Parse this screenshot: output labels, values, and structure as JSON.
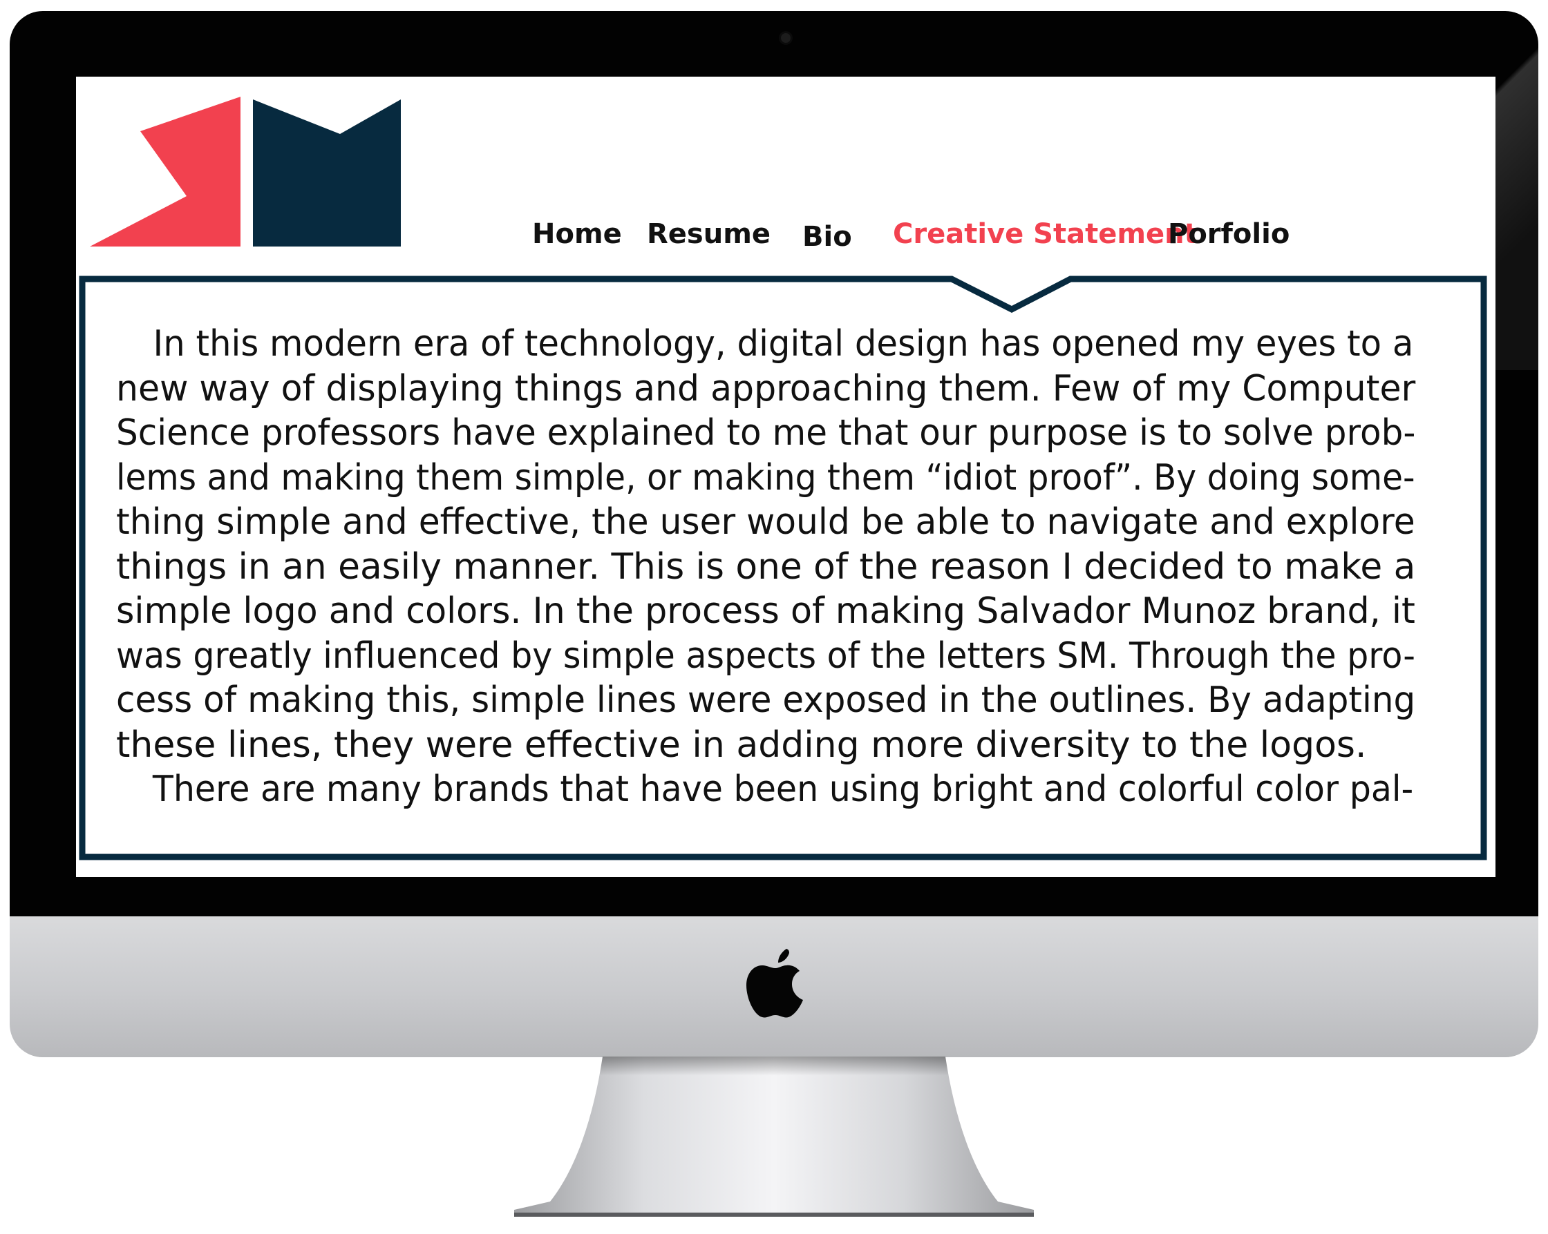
{
  "nav": {
    "items": [
      {
        "label": "Home",
        "active": false
      },
      {
        "label": "Resume",
        "active": false
      },
      {
        "label": "Bio",
        "active": false
      },
      {
        "label": "Creative Statement",
        "active": true
      },
      {
        "label": "Porfolio",
        "active": false
      }
    ]
  },
  "colors": {
    "brand_red": "#f2414f",
    "brand_navy": "#072a3f",
    "text": "#111111"
  },
  "statement": {
    "lines": [
      "In this modern era of technology, digital design has opened my eyes to a",
      "new way of displaying things and approaching them. Few of my Computer",
      "Science professors have explained to me that our purpose is to solve prob-",
      "lems and making them simple, or making them “idiot proof”. By doing some-",
      "thing simple and effective, the user would be able to navigate and explore",
      "things in an easily manner. This is one of the reason I decided to make a",
      "simple logo and colors. In the process of making Salvador Munoz brand, it",
      "was greatly influenced by simple aspects of the letters SM. Through the pro-",
      "cess of making this, simple lines were exposed in the outlines. By adapting",
      "these lines, they were effective in adding more diversity to the logos.",
      "There are many brands that have been using bright and colorful color pal-"
    ]
  },
  "icons": {
    "logo": "sm-logo",
    "device_logo": "apple-icon",
    "camera": "camera-icon"
  }
}
